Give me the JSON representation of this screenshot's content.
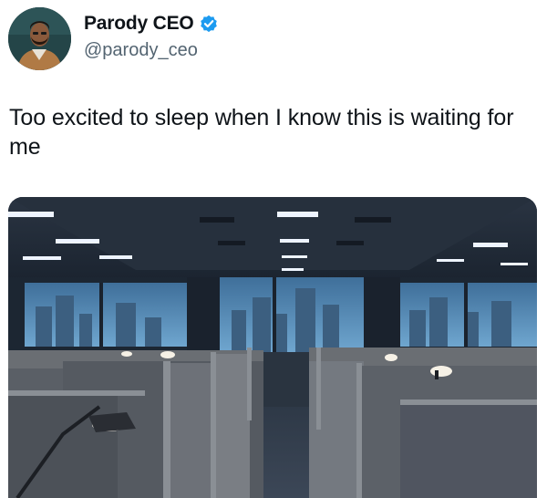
{
  "author": {
    "display_name": "Parody CEO",
    "handle": "@parody_ceo",
    "verified": true,
    "avatar_icon": "person-avatar",
    "verified_icon": "verified-badge-icon"
  },
  "tweet": {
    "text": "Too excited to sleep when I know this is waiting for me"
  },
  "colors": {
    "text": "#0f1419",
    "secondary": "#536471",
    "verified": "#1d9bf0"
  }
}
